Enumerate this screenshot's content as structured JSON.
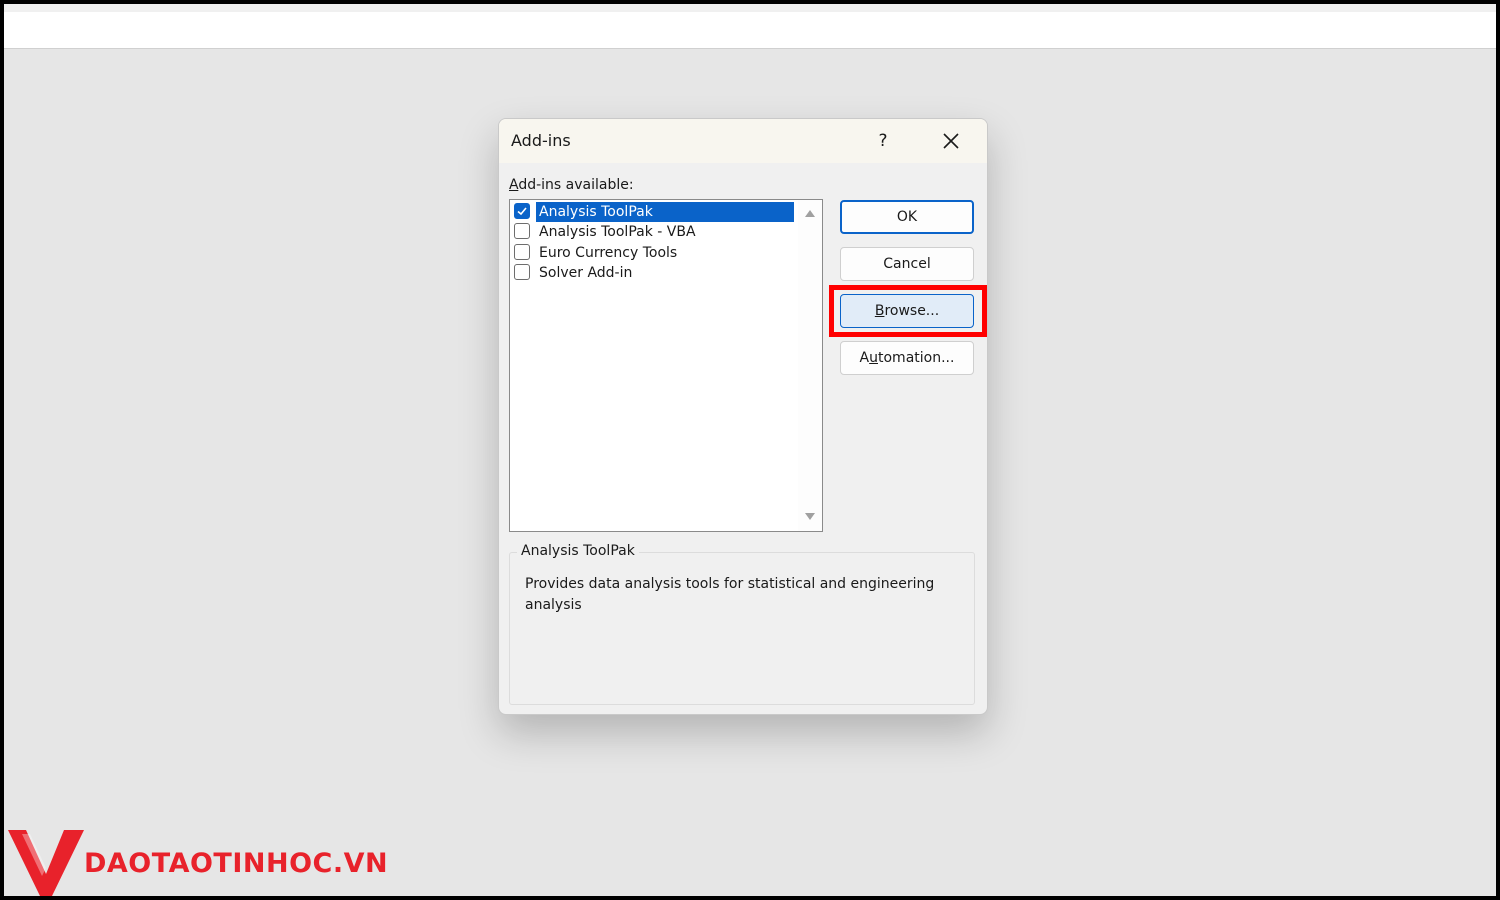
{
  "dialog": {
    "title": "Add-ins",
    "help_label": "?",
    "available_label_accel": "A",
    "available_label_rest": "dd-ins available:",
    "items": [
      {
        "label": "Analysis ToolPak",
        "checked": true,
        "selected": true
      },
      {
        "label": "Analysis ToolPak - VBA",
        "checked": false,
        "selected": false
      },
      {
        "label": "Euro Currency Tools",
        "checked": false,
        "selected": false
      },
      {
        "label": "Solver Add-in",
        "checked": false,
        "selected": false
      }
    ],
    "buttons": {
      "ok": "OK",
      "cancel": "Cancel",
      "browse_accel": "B",
      "browse_rest": "rowse...",
      "automation_pre": "A",
      "automation_accel": "u",
      "automation_rest": "tomation..."
    },
    "description": {
      "title": "Analysis ToolPak",
      "text": "Provides data analysis tools for statistical and engineering analysis"
    }
  },
  "watermark": {
    "text": "DAOTAOTINHOC.VN"
  },
  "colors": {
    "accent": "#0a63c9",
    "highlight": "#ff0000",
    "brand": "#e8222b"
  }
}
